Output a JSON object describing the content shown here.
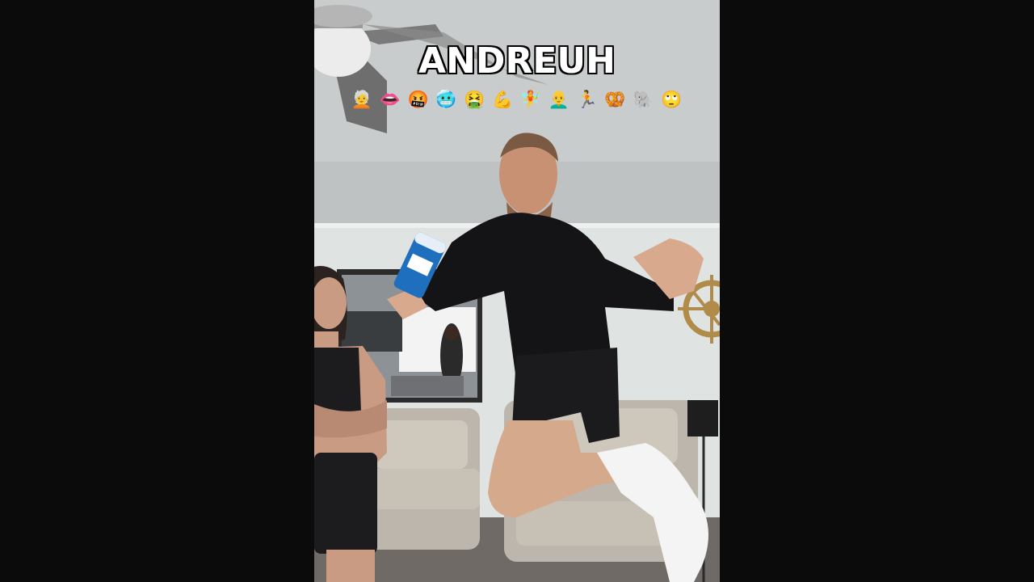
{
  "video": {
    "caption_title": "ANDREUH",
    "emoji_caption": [
      "🧑‍🦳",
      "👄",
      "🤬",
      "🥶",
      "🤮",
      "💪",
      "🧚",
      "👨‍🦲",
      "🏃",
      "🥨",
      "🐘",
      "🙄"
    ]
  }
}
